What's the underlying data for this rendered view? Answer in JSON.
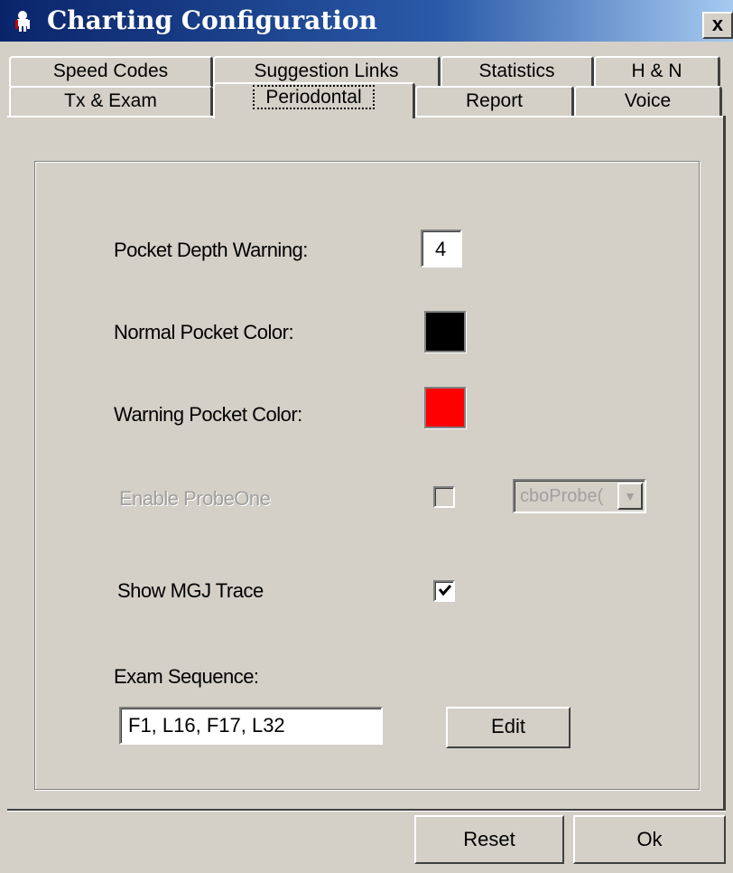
{
  "window": {
    "title": "Charting Configuration",
    "close_label": "x",
    "icon": "app-tooth-icon"
  },
  "tabs_row1": [
    {
      "label": "Speed Codes",
      "mnemonic": "C"
    },
    {
      "label": "Suggestion Links",
      "mnemonic": ""
    },
    {
      "label": "Statistics",
      "mnemonic": "S"
    },
    {
      "label": "H & N",
      "mnemonic": "H"
    }
  ],
  "tabs_row2": [
    {
      "label": "Tx & Exam",
      "mnemonic": "T"
    },
    {
      "label": "Periodontal",
      "mnemonic": "P",
      "selected": true
    },
    {
      "label": "Report",
      "mnemonic": "R"
    },
    {
      "label": "Voice",
      "mnemonic": "V"
    }
  ],
  "periodontal": {
    "pocket_depth_label": "Pocket Depth Warning:",
    "pocket_depth_value": "4",
    "normal_color_label": "Normal Pocket Color:",
    "normal_color": "#000000",
    "warning_color_label": "Warning Pocket Color:",
    "warning_color": "#ff0000",
    "probeone_label": "Enable ProbeOne",
    "probeone_checked": false,
    "probeone_combo_text": "cboProbe(",
    "mgj_label": "Show MGJ Trace",
    "mgj_checked": true,
    "exam_sequence_label": "Exam Sequence:",
    "exam_sequence_value": "F1, L16, F17, L32",
    "edit_label": "Edit"
  },
  "footer": {
    "reset_label": "Reset",
    "ok_label": "Ok"
  }
}
